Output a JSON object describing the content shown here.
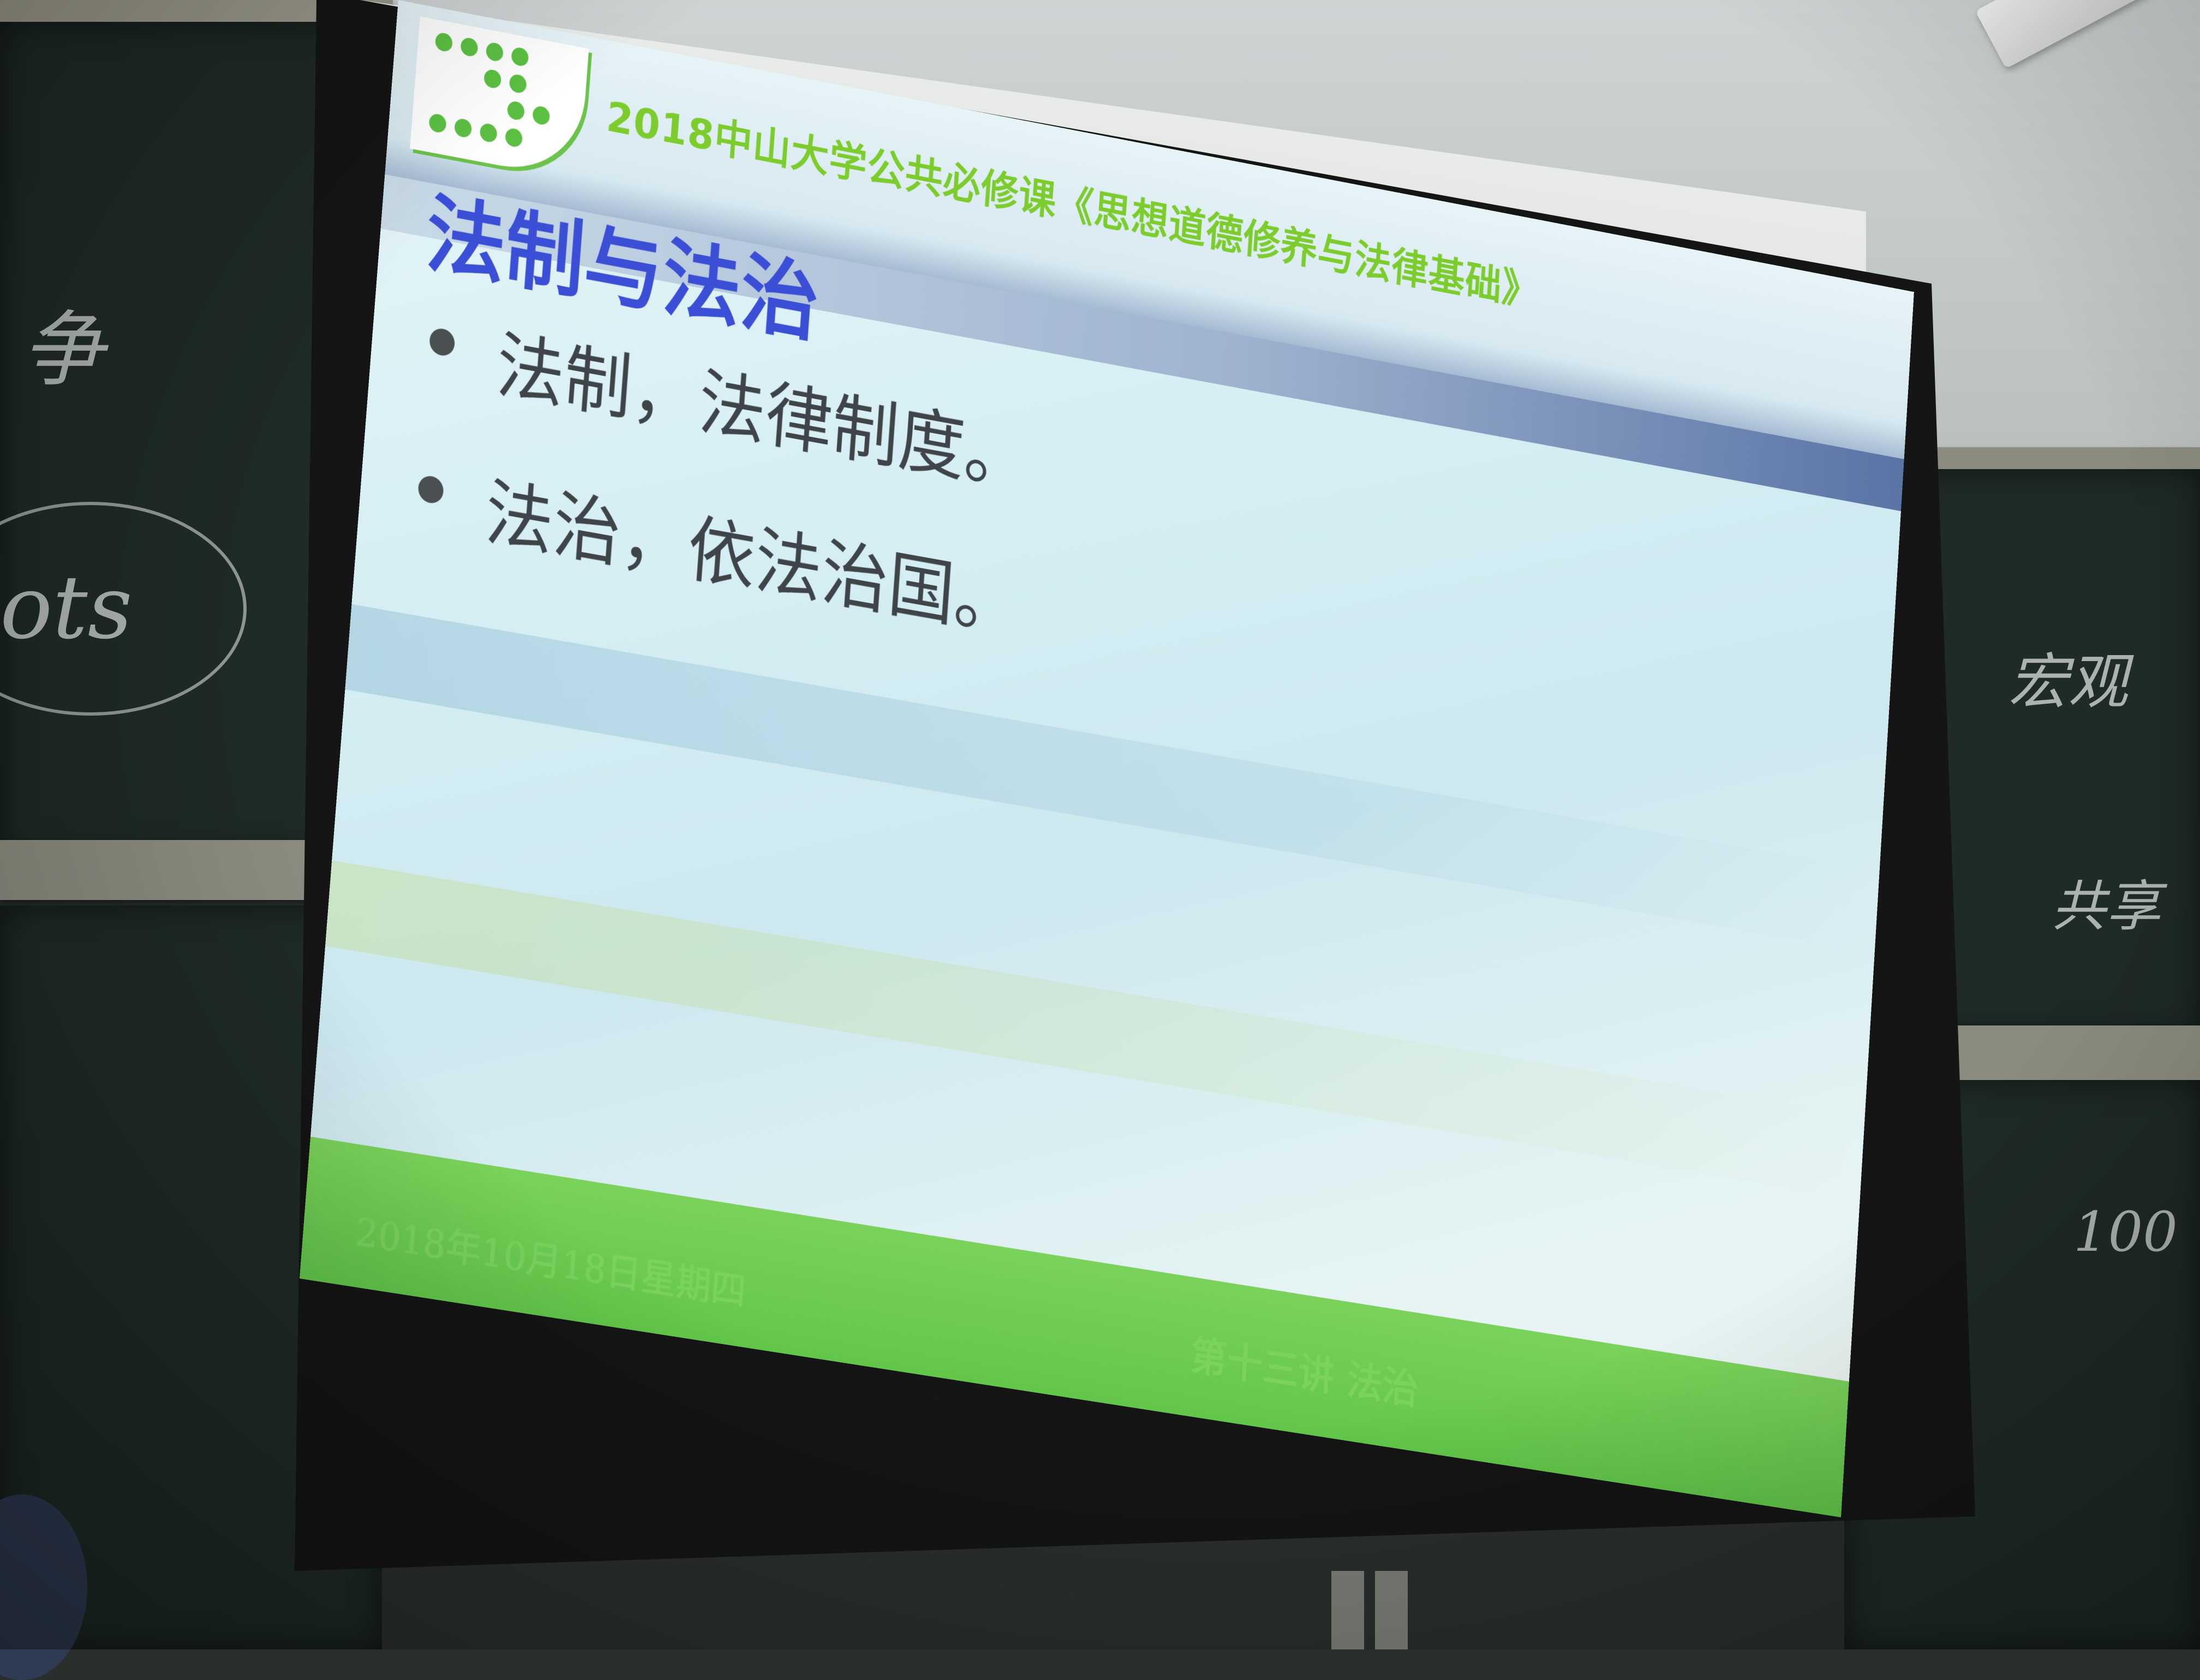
{
  "slide": {
    "course_title": "2018中山大学公共必修课《思想道德修养与法律基础》",
    "title": "法制与法治",
    "bullets": [
      "法制，法律制度。",
      "法治，依法治国。"
    ],
    "footer_date": "2018年10月18日星期四",
    "footer_chapter": "第十三讲 法治"
  },
  "blackboard": {
    "left_chalk_1": "争",
    "left_chalk_2": "ots",
    "right_chalk_1": "宏观",
    "right_chalk_2": "共享",
    "right_chalk_3": "100"
  },
  "colors": {
    "slide_title": "#3a4fd6",
    "course_title": "#7bcc2c",
    "footer_band": "#6cca4e",
    "header_bar": "#5a74a6",
    "blackboard": "#1f2b27"
  }
}
